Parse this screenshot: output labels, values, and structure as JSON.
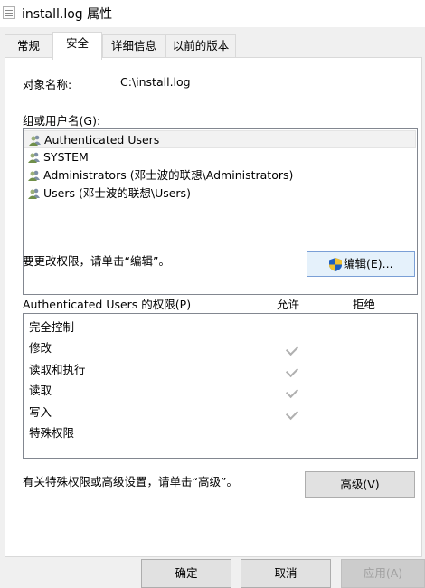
{
  "window": {
    "title": "install.log 属性"
  },
  "tabs": [
    {
      "label": "常规"
    },
    {
      "label": "安全"
    },
    {
      "label": "详细信息"
    },
    {
      "label": "以前的版本"
    }
  ],
  "object": {
    "label": "对象名称:",
    "value": "C:\\install.log"
  },
  "groups": {
    "label": "组或用户名(G):",
    "items": [
      {
        "label": "Authenticated Users"
      },
      {
        "label": "SYSTEM"
      },
      {
        "label": "Administrators (邓士波的联想\\Administrators)"
      },
      {
        "label": "Users (邓士波的联想\\Users)"
      }
    ]
  },
  "edit": {
    "hint": "要更改权限，请单击“编辑”。",
    "button_label": "编辑(E)..."
  },
  "permissions": {
    "header": "Authenticated Users 的权限(P)",
    "allow_label": "允许",
    "deny_label": "拒绝",
    "rows": [
      {
        "name": "完全控制",
        "allow": false,
        "deny": false
      },
      {
        "name": "修改",
        "allow": true,
        "deny": false
      },
      {
        "name": "读取和执行",
        "allow": true,
        "deny": false
      },
      {
        "name": "读取",
        "allow": true,
        "deny": false
      },
      {
        "name": "写入",
        "allow": true,
        "deny": false
      },
      {
        "name": "特殊权限",
        "allow": false,
        "deny": false
      }
    ]
  },
  "advanced": {
    "hint": "有关特殊权限或高级设置，请单击“高级”。",
    "button_label": "高级(V)"
  },
  "footer": {
    "ok_label": "确定",
    "cancel_label": "取消",
    "apply_label": "应用(A)"
  },
  "colors": {
    "accent": "#0078d7",
    "check": "#b0b0b0",
    "shield_blue": "#1f5fbf",
    "shield_yellow": "#f2c230"
  }
}
